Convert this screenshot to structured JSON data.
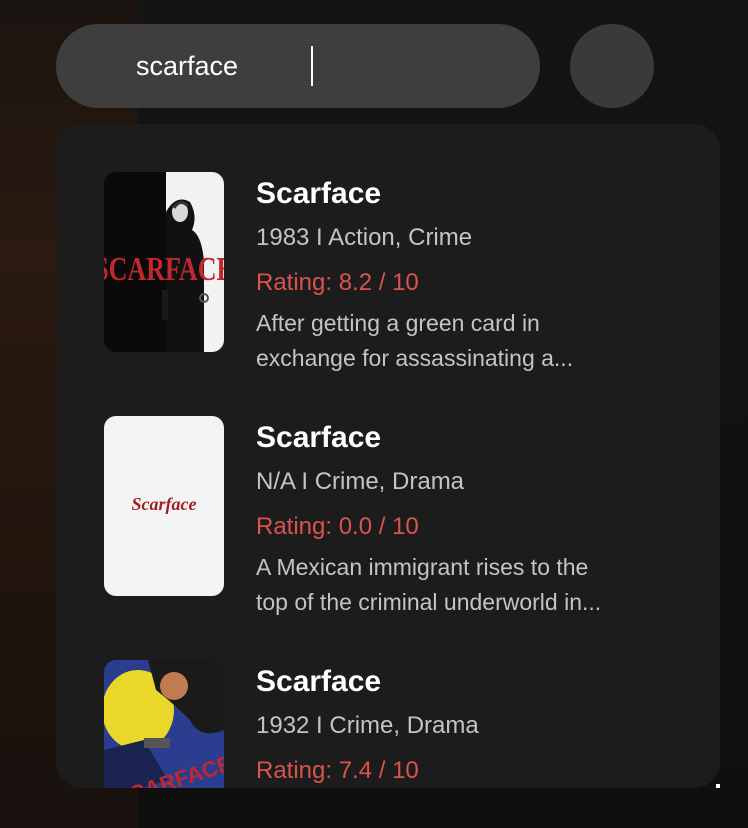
{
  "search": {
    "value": "scarface"
  },
  "results": [
    {
      "title": "Scarface",
      "meta": "1983 I Action, Crime",
      "rating": "Rating: 8.2 / 10",
      "description_line1": "After getting a green card in",
      "description_line2": "exchange for assassinating a...",
      "poster_text": "SCARFACE"
    },
    {
      "title": "Scarface",
      "meta": "N/A I Crime, Drama",
      "rating": "Rating: 0.0 / 10",
      "description_line1": "A Mexican immigrant rises to the",
      "description_line2": "top of the criminal underworld in...",
      "poster_text": "Scarface"
    },
    {
      "title": "Scarface",
      "meta": "1932 I Crime, Drama",
      "rating": "Rating: 7.4 / 10",
      "poster_text": "SCARFACE"
    }
  ],
  "colors": {
    "rating": "#d9534f",
    "panel": "#1c1c1c",
    "search_bar": "#3e3e3e"
  }
}
